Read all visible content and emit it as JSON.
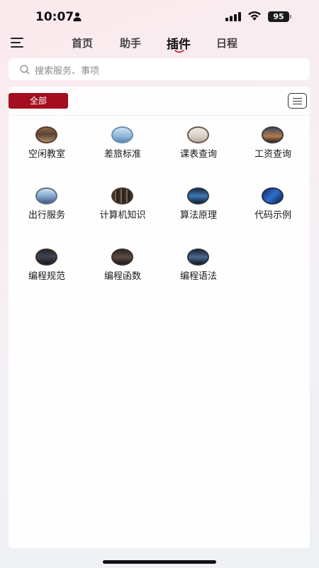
{
  "status_bar": {
    "time": "10:07",
    "battery": "95"
  },
  "nav": {
    "tabs": [
      {
        "label": "首页"
      },
      {
        "label": "助手"
      },
      {
        "label": "插件"
      },
      {
        "label": "日程"
      }
    ],
    "active_tab": "插件"
  },
  "search": {
    "placeholder": "搜索服务、事项"
  },
  "filter": {
    "label": "全部"
  },
  "plugins": [
    {
      "label": "空闲教室",
      "icon": "classroom-icon"
    },
    {
      "label": "差旅标准",
      "icon": "airplane-icon"
    },
    {
      "label": "课表查询",
      "icon": "schedule-icon"
    },
    {
      "label": "工资查询",
      "icon": "city-icon"
    },
    {
      "label": "出行服务",
      "icon": "travel-icon"
    },
    {
      "label": "计算机知识",
      "icon": "library-icon"
    },
    {
      "label": "算法原理",
      "icon": "server-icon"
    },
    {
      "label": "代码示例",
      "icon": "circuit-icon"
    },
    {
      "label": "编程规范",
      "icon": "monitor-icon"
    },
    {
      "label": "编程函数",
      "icon": "workstation-icon"
    },
    {
      "label": "编程语法",
      "icon": "code-screen-icon"
    }
  ],
  "colors": {
    "accent": "#a30f1e",
    "background": "#f3eef2"
  }
}
